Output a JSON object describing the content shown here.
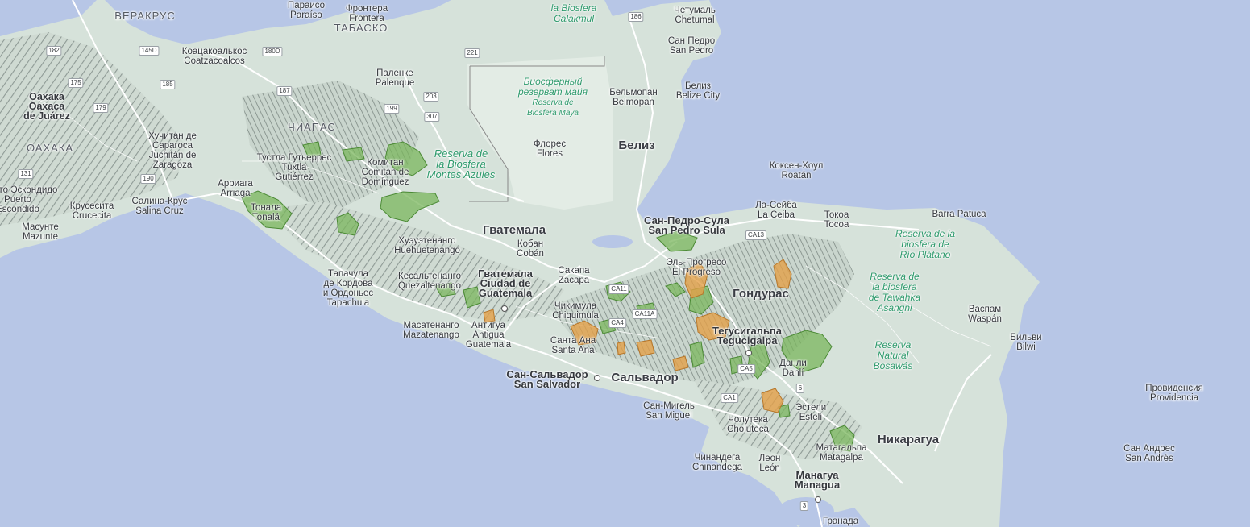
{
  "colors": {
    "water": "#b7c6e6",
    "land": "#d6e2da",
    "green_area": "#7ab55c",
    "orange_area": "#e3a049"
  },
  "states": [
    "ВЕРАКРУС",
    "ТАБАСКО",
    "ЧИАПАС",
    "ОАХАКА"
  ],
  "countries": [
    "Гватемала",
    "Белиз",
    "Гондурас",
    "Сальвадор",
    "Никарагуа"
  ],
  "cities": [
    {
      "ru": "Параисо",
      "local": "Paraíso"
    },
    {
      "ru": "Фронтера",
      "local": "Frontera"
    },
    {
      "ru": "Коацакоалькос",
      "local": "Coatzacoalcos"
    },
    {
      "ru": "Паленке",
      "local": "Palenque"
    },
    {
      "ru": "Четумаль",
      "local": "Chetumal"
    },
    {
      "ru": "Сан Педро",
      "local": "San Pedro"
    },
    {
      "ru": "Бельмопан",
      "local": "Belmopan"
    },
    {
      "ru": "Белиз",
      "local": "Belize City"
    },
    {
      "ru": "Оахака",
      "local": "Oaxaca",
      "extra": "de Juárez"
    },
    {
      "ru": "Хучитан де",
      "local": "Сарагоса",
      "extra": "Juchitán de",
      "extra2": "Zaragoza"
    },
    {
      "ru": "Тустла Гутьеррес",
      "local": "Tuxtla",
      "extra": "Gutiérrez"
    },
    {
      "ru": "Комитан",
      "local": "Comitán de",
      "extra": "Domínguez"
    },
    {
      "ru": "Флорес",
      "local": "Flores"
    },
    {
      "ru": "Коксен-Хоул",
      "local": "Roatán"
    },
    {
      "ru": "Ла-Сейба",
      "local": "La Ceiba"
    },
    {
      "ru": "Токоа",
      "local": "Tocoa"
    },
    {
      "ru": "Barra Patuca",
      "local": ""
    },
    {
      "ru": "Арриага",
      "local": "Arriaga"
    },
    {
      "ru": "Салина-Крус",
      "local": "Salina Cruz"
    },
    {
      "ru": "Крусесита",
      "local": "Crucecita"
    },
    {
      "ru": "Масунте",
      "local": "Mazunte"
    },
    {
      "ru": "Тонала",
      "local": "Tonalá"
    },
    {
      "ru": "Сан-Педро-Сула",
      "local": "San Pedro Sula"
    },
    {
      "ru": "Хуэуэтенанго",
      "local": "Huehuetenango"
    },
    {
      "ru": "Кобан",
      "local": "Cobán"
    },
    {
      "ru": "Эль-Прогресо",
      "local": "El Progreso"
    },
    {
      "ru": "Тапачула",
      "local": "де Кордова",
      "extra": "и Ордоньес",
      "extra2": "Tapachula"
    },
    {
      "ru": "Кесальтенанго",
      "local": "Quezaltenango"
    },
    {
      "ru": "Гватемала",
      "local": "Ciudad de",
      "extra": "Guatemala"
    },
    {
      "ru": "Сакапа",
      "local": "Zacapa"
    },
    {
      "ru": "Чикимула",
      "local": "Chiquimula"
    },
    {
      "ru": "Масатенанго",
      "local": "Mazatenango"
    },
    {
      "ru": "Антигуа",
      "local": "Antigua",
      "extra": "Guatemala"
    },
    {
      "ru": "Санта Ана",
      "local": "Santa Ana"
    },
    {
      "ru": "Тегусигальпа",
      "local": "Tegucigalpa"
    },
    {
      "ru": "Васпам",
      "local": "Waspán"
    },
    {
      "ru": "Бильви",
      "local": "Bilwi"
    },
    {
      "ru": "Данли",
      "local": "Danlí"
    },
    {
      "ru": "Сан-Сальвадор",
      "local": "San Salvador"
    },
    {
      "ru": "Сан-Мигель",
      "local": "San Miguel"
    },
    {
      "ru": "Чолутека",
      "local": "Choluteca"
    },
    {
      "ru": "Эстели",
      "local": "Estelí"
    },
    {
      "ru": "Провиденсия",
      "local": "Providencia"
    },
    {
      "ru": "Матагальпа",
      "local": "Matagalpa"
    },
    {
      "ru": "Сан Андрес",
      "local": "San Andrés"
    },
    {
      "ru": "Чинандега",
      "local": "Chinandega"
    },
    {
      "ru": "Леон",
      "local": "León"
    },
    {
      "ru": "Манагуа",
      "local": "Managua"
    },
    {
      "ru": "Гранада",
      "local": ""
    },
    {
      "ru": "Пуэрто Эскондидо",
      "local": "Puerto",
      "extra": "Escondido"
    }
  ],
  "reserves": [
    {
      "line1": "la Biosfera",
      "line2": "Calakmul"
    },
    {
      "line1": "Биосферный",
      "line2": "резерват майя",
      "line3": "Reserva de",
      "line4": "Biosfera Maya"
    },
    {
      "line1": "Reserva de",
      "line2": "la Biosfera",
      "line3": "Montes Azules"
    },
    {
      "line1": "Reserva de la",
      "line2": "biosfera de",
      "line3": "Río Plátano"
    },
    {
      "line1": "Reserva de",
      "line2": "la biosfera",
      "line3": "de Tawahka",
      "line4": "Asangni"
    },
    {
      "line1": "Reserva",
      "line2": "Natural",
      "line3": "Bosawás"
    }
  ],
  "shields": [
    "182",
    "145D",
    "180D",
    "187",
    "185",
    "175",
    "179",
    "199",
    "203",
    "307",
    "221",
    "186",
    "131",
    "190",
    "CA13",
    "CA11",
    "CA11A",
    "CA4",
    "CA5",
    "CA1",
    "6",
    "3"
  ]
}
